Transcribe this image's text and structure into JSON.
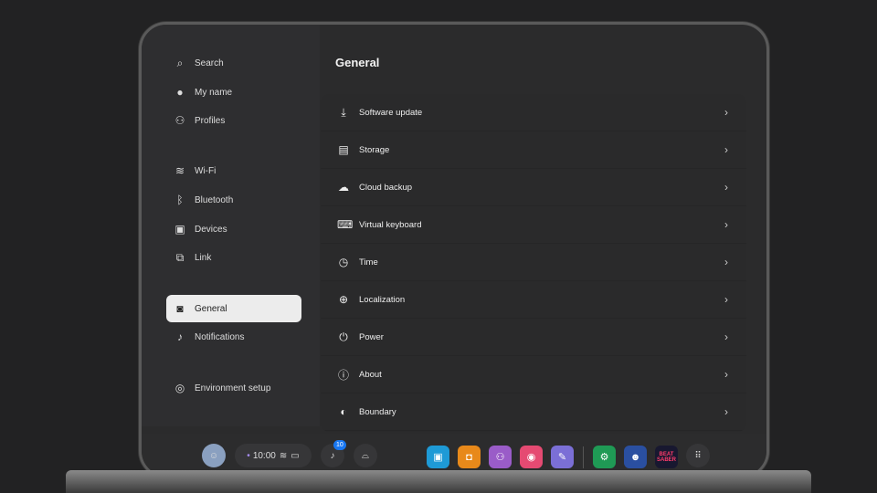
{
  "sidebar": {
    "items": [
      {
        "label": "Search",
        "icon": "search-icon"
      },
      {
        "label": "My name",
        "icon": "user-icon"
      },
      {
        "label": "Profiles",
        "icon": "profiles-icon"
      },
      {
        "label": "Wi-Fi",
        "icon": "wifi-icon"
      },
      {
        "label": "Bluetooth",
        "icon": "bluetooth-icon"
      },
      {
        "label": "Devices",
        "icon": "devices-icon"
      },
      {
        "label": "Link",
        "icon": "link-icon"
      },
      {
        "label": "General",
        "icon": "headset-icon",
        "active": true
      },
      {
        "label": "Notifications",
        "icon": "bell-icon"
      },
      {
        "label": "Environment setup",
        "icon": "environment-icon"
      }
    ]
  },
  "main": {
    "title": "General",
    "items": [
      {
        "label": "Software update",
        "icon": "download-icon"
      },
      {
        "label": "Storage",
        "icon": "storage-icon"
      },
      {
        "label": "Cloud backup",
        "icon": "cloud-icon"
      },
      {
        "label": "Virtual keyboard",
        "icon": "keyboard-icon"
      },
      {
        "label": "Time",
        "icon": "clock-icon"
      },
      {
        "label": "Localization",
        "icon": "globe-icon"
      },
      {
        "label": "Power",
        "icon": "power-icon"
      },
      {
        "label": "About",
        "icon": "info-icon"
      },
      {
        "label": "Boundary",
        "icon": "boundary-icon"
      }
    ]
  },
  "dock": {
    "time": "10:00",
    "notification_count": "10",
    "game_label": "BEAT SABER",
    "apps": [
      {
        "name": "store",
        "color": "#1e9ad6"
      },
      {
        "name": "shop",
        "color": "#e8891a"
      },
      {
        "name": "people",
        "color": "#9a5cc8"
      },
      {
        "name": "camera",
        "color": "#e54a72"
      },
      {
        "name": "explore",
        "color": "#7b6fd6"
      }
    ]
  }
}
